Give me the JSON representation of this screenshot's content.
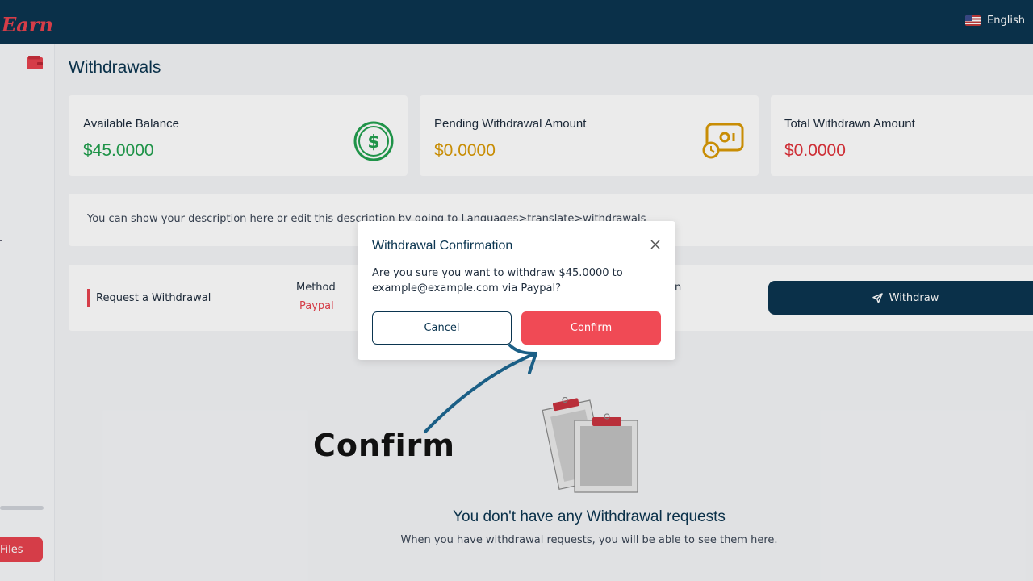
{
  "header": {
    "logo_text": "Earn",
    "language": "English"
  },
  "sidebar": {
    "bottom_button_label": "Files"
  },
  "page": {
    "title": "Withdrawals"
  },
  "stats": [
    {
      "label": "Available Balance",
      "value": "$45.0000",
      "color": "#22a04f",
      "icon": "dollar-circle-icon"
    },
    {
      "label": "Pending Withdrawal Amount",
      "value": "$0.0000",
      "color": "#d99a06",
      "icon": "pending-money-icon"
    },
    {
      "label": "Total Withdrawn Amount",
      "value": "$0.0000",
      "color": "#e0333b",
      "icon": "withdrawn-icon"
    }
  ],
  "description": "You can show your description here or edit this description by going to Languages>translate>withdrawals",
  "request": {
    "title": "Request a Withdrawal",
    "method_label": "Method",
    "method_value": "Paypal",
    "partial_label": "n",
    "withdraw_button": "Withdraw"
  },
  "empty_state": {
    "title": "You don't have any Withdrawal requests",
    "subtitle": "When you have withdrawal requests, you will be able to see them here."
  },
  "modal": {
    "title": "Withdrawal Confirmation",
    "message": "Are you sure you want to withdraw $45.0000 to example@example.com via Paypal?",
    "cancel_label": "Cancel",
    "confirm_label": "Confirm"
  },
  "annotation": {
    "text": "Confirm"
  },
  "colors": {
    "primary": "#0b3550",
    "accent": "#e8434f",
    "confirm": "#f04a55"
  }
}
